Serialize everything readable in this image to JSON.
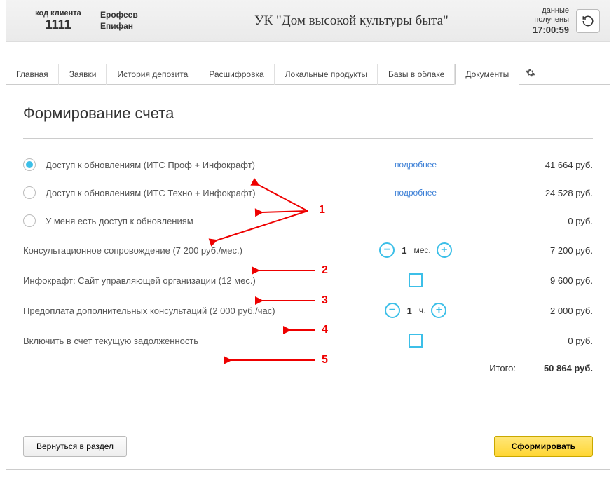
{
  "header": {
    "client_code_label": "код клиента",
    "client_code": "1111",
    "client_name_line1": "Ерофеев",
    "client_name_line2": "Епифан",
    "company": "УК \"Дом высокой культуры быта\"",
    "data_received_label1": "данные",
    "data_received_label2": "получены",
    "data_received_time": "17:00:59"
  },
  "tabs": {
    "main": "Главная",
    "requests": "Заявки",
    "deposit_history": "История депозита",
    "decoding": "Расшифровка",
    "local_products": "Локальные продукты",
    "cloud_db": "Базы в облаке",
    "documents": "Документы"
  },
  "page": {
    "title": "Формирование счета",
    "more": "подробнее",
    "currency": "руб.",
    "unit_month": "мес.",
    "unit_hour": "ч.",
    "total_label": "Итого:",
    "back_btn": "Вернуться в раздел",
    "submit_btn": "Сформировать"
  },
  "options": [
    {
      "label": "Доступ к обновлениям (ИТС Проф + Инфокрафт)",
      "price": "41 664",
      "more": true,
      "checked": true
    },
    {
      "label": "Доступ к обновлениям (ИТС Техно + Инфокрафт)",
      "price": "24 528",
      "more": true,
      "checked": false
    },
    {
      "label": "У меня есть доступ к обновлениям",
      "price": "0",
      "more": false,
      "checked": false
    }
  ],
  "lines": [
    {
      "label": "Консультационное сопровождение (7 200 руб./мес.)",
      "control": "stepper",
      "value": "1",
      "unit": "мес.",
      "price": "7 200"
    },
    {
      "label": "Инфокрафт: Сайт управляющей организации (12 мес.)",
      "control": "checkbox",
      "price": "9 600"
    },
    {
      "label": "Предоплата дополнительных консультаций (2 000 руб./час)",
      "control": "stepper",
      "value": "1",
      "unit": "ч.",
      "price": "2 000"
    },
    {
      "label": "Включить в счет текущую задолженность",
      "control": "checkbox",
      "price": "0"
    }
  ],
  "total": "50 864",
  "annotations": {
    "n1": "1",
    "n2": "2",
    "n3": "3",
    "n4": "4",
    "n5": "5"
  }
}
